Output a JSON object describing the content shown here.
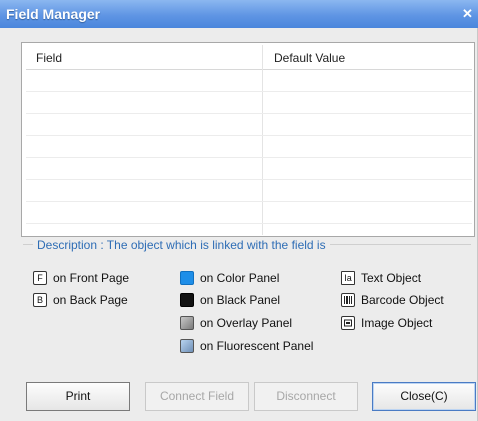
{
  "window": {
    "title": "Field Manager",
    "close_glyph": "✕"
  },
  "table": {
    "columns": [
      "Field",
      "Default Value"
    ],
    "rows": []
  },
  "description": {
    "title": "Description : The object which is linked with the field is",
    "items": {
      "front_page": {
        "icon": "front-page-icon",
        "glyph": "F",
        "label": "on Front Page"
      },
      "back_page": {
        "icon": "back-page-icon",
        "glyph": "B",
        "label": "on Back Page"
      },
      "color_panel": {
        "icon": "color-panel-icon",
        "color": "#1e8ee8",
        "label": "on Color Panel"
      },
      "black_panel": {
        "icon": "black-panel-icon",
        "color": "#111111",
        "label": "on Black Panel"
      },
      "overlay_panel": {
        "icon": "overlay-panel-icon",
        "label": "on Overlay Panel"
      },
      "fluorescent_panel": {
        "icon": "fluorescent-panel-icon",
        "label": "on Fluorescent Panel"
      },
      "text_object": {
        "icon": "text-object-icon",
        "glyph": "Ia",
        "label": "Text Object"
      },
      "barcode_object": {
        "icon": "barcode-object-icon",
        "label": "Barcode Object"
      },
      "image_object": {
        "icon": "image-object-icon",
        "label": "Image Object"
      }
    }
  },
  "buttons": {
    "print": "Print",
    "connect_field": "Connect Field",
    "disconnect": "Disconnect",
    "close": "Close(C)"
  }
}
